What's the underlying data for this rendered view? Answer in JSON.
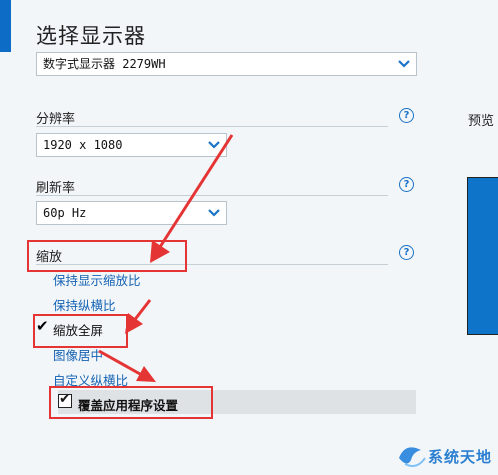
{
  "page": {
    "title": "选择显示器"
  },
  "display_select": {
    "value": "数字式显示器 2279WH"
  },
  "resolution": {
    "label": "分辨率",
    "value": "1920 x 1080"
  },
  "refresh": {
    "label": "刷新率",
    "value": "60p Hz"
  },
  "scaling": {
    "label": "缩放",
    "options": [
      {
        "label": "保持显示缩放比",
        "checked": false
      },
      {
        "label": "保持纵横比",
        "checked": false
      },
      {
        "label": "缩放全屏",
        "checked": true
      },
      {
        "label": "图像居中",
        "checked": false
      },
      {
        "label": "自定义纵横比",
        "checked": false
      }
    ],
    "override": {
      "label": "覆盖应用程序设置",
      "checked": true
    }
  },
  "help_glyph": "?",
  "check_glyph": "✔",
  "preview": {
    "label": "预览"
  },
  "watermark": {
    "text": "系统天地"
  },
  "colors": {
    "accent": "#1463b3",
    "annotation_red": "#e53434",
    "preview_blue": "#0d74c9"
  },
  "icons": {
    "help": "help-icon",
    "chevron": "chevron-down-icon",
    "check": "check-icon"
  }
}
